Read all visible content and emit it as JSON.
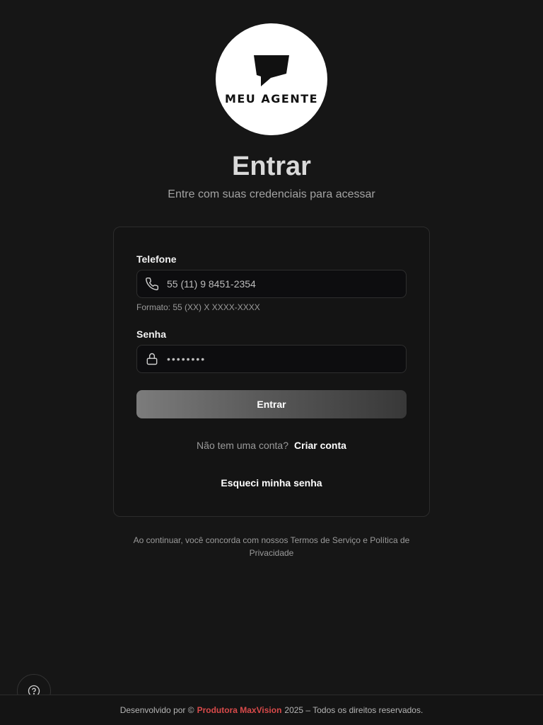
{
  "logo": {
    "text": "MEU AGENTE"
  },
  "header": {
    "title": "Entrar",
    "subtitle": "Entre com suas credenciais para acessar"
  },
  "form": {
    "phone_label": "Telefone",
    "phone_value": "55 (11) 9 8451-2354",
    "phone_hint": "Formato: 55 (XX) X XXXX-XXXX",
    "password_label": "Senha",
    "password_value": "••••••••",
    "submit_label": "Entrar",
    "no_account_text": "Não tem uma conta?",
    "create_account_label": "Criar conta",
    "forgot_password_label": "Esqueci minha senha"
  },
  "terms": "Ao continuar, você concorda com nossos Termos de Serviço e Política de Privacidade",
  "footer": {
    "prefix": "Desenvolvido por ©",
    "brand": "Produtora MaxVision",
    "suffix": "2025 – Todos os direitos reservados."
  },
  "colors": {
    "background": "#161616",
    "accent_brand": "#d94a4a"
  },
  "icons": [
    "speech-bubble-logo-icon",
    "phone-icon",
    "lock-icon",
    "help-circle-icon"
  ]
}
